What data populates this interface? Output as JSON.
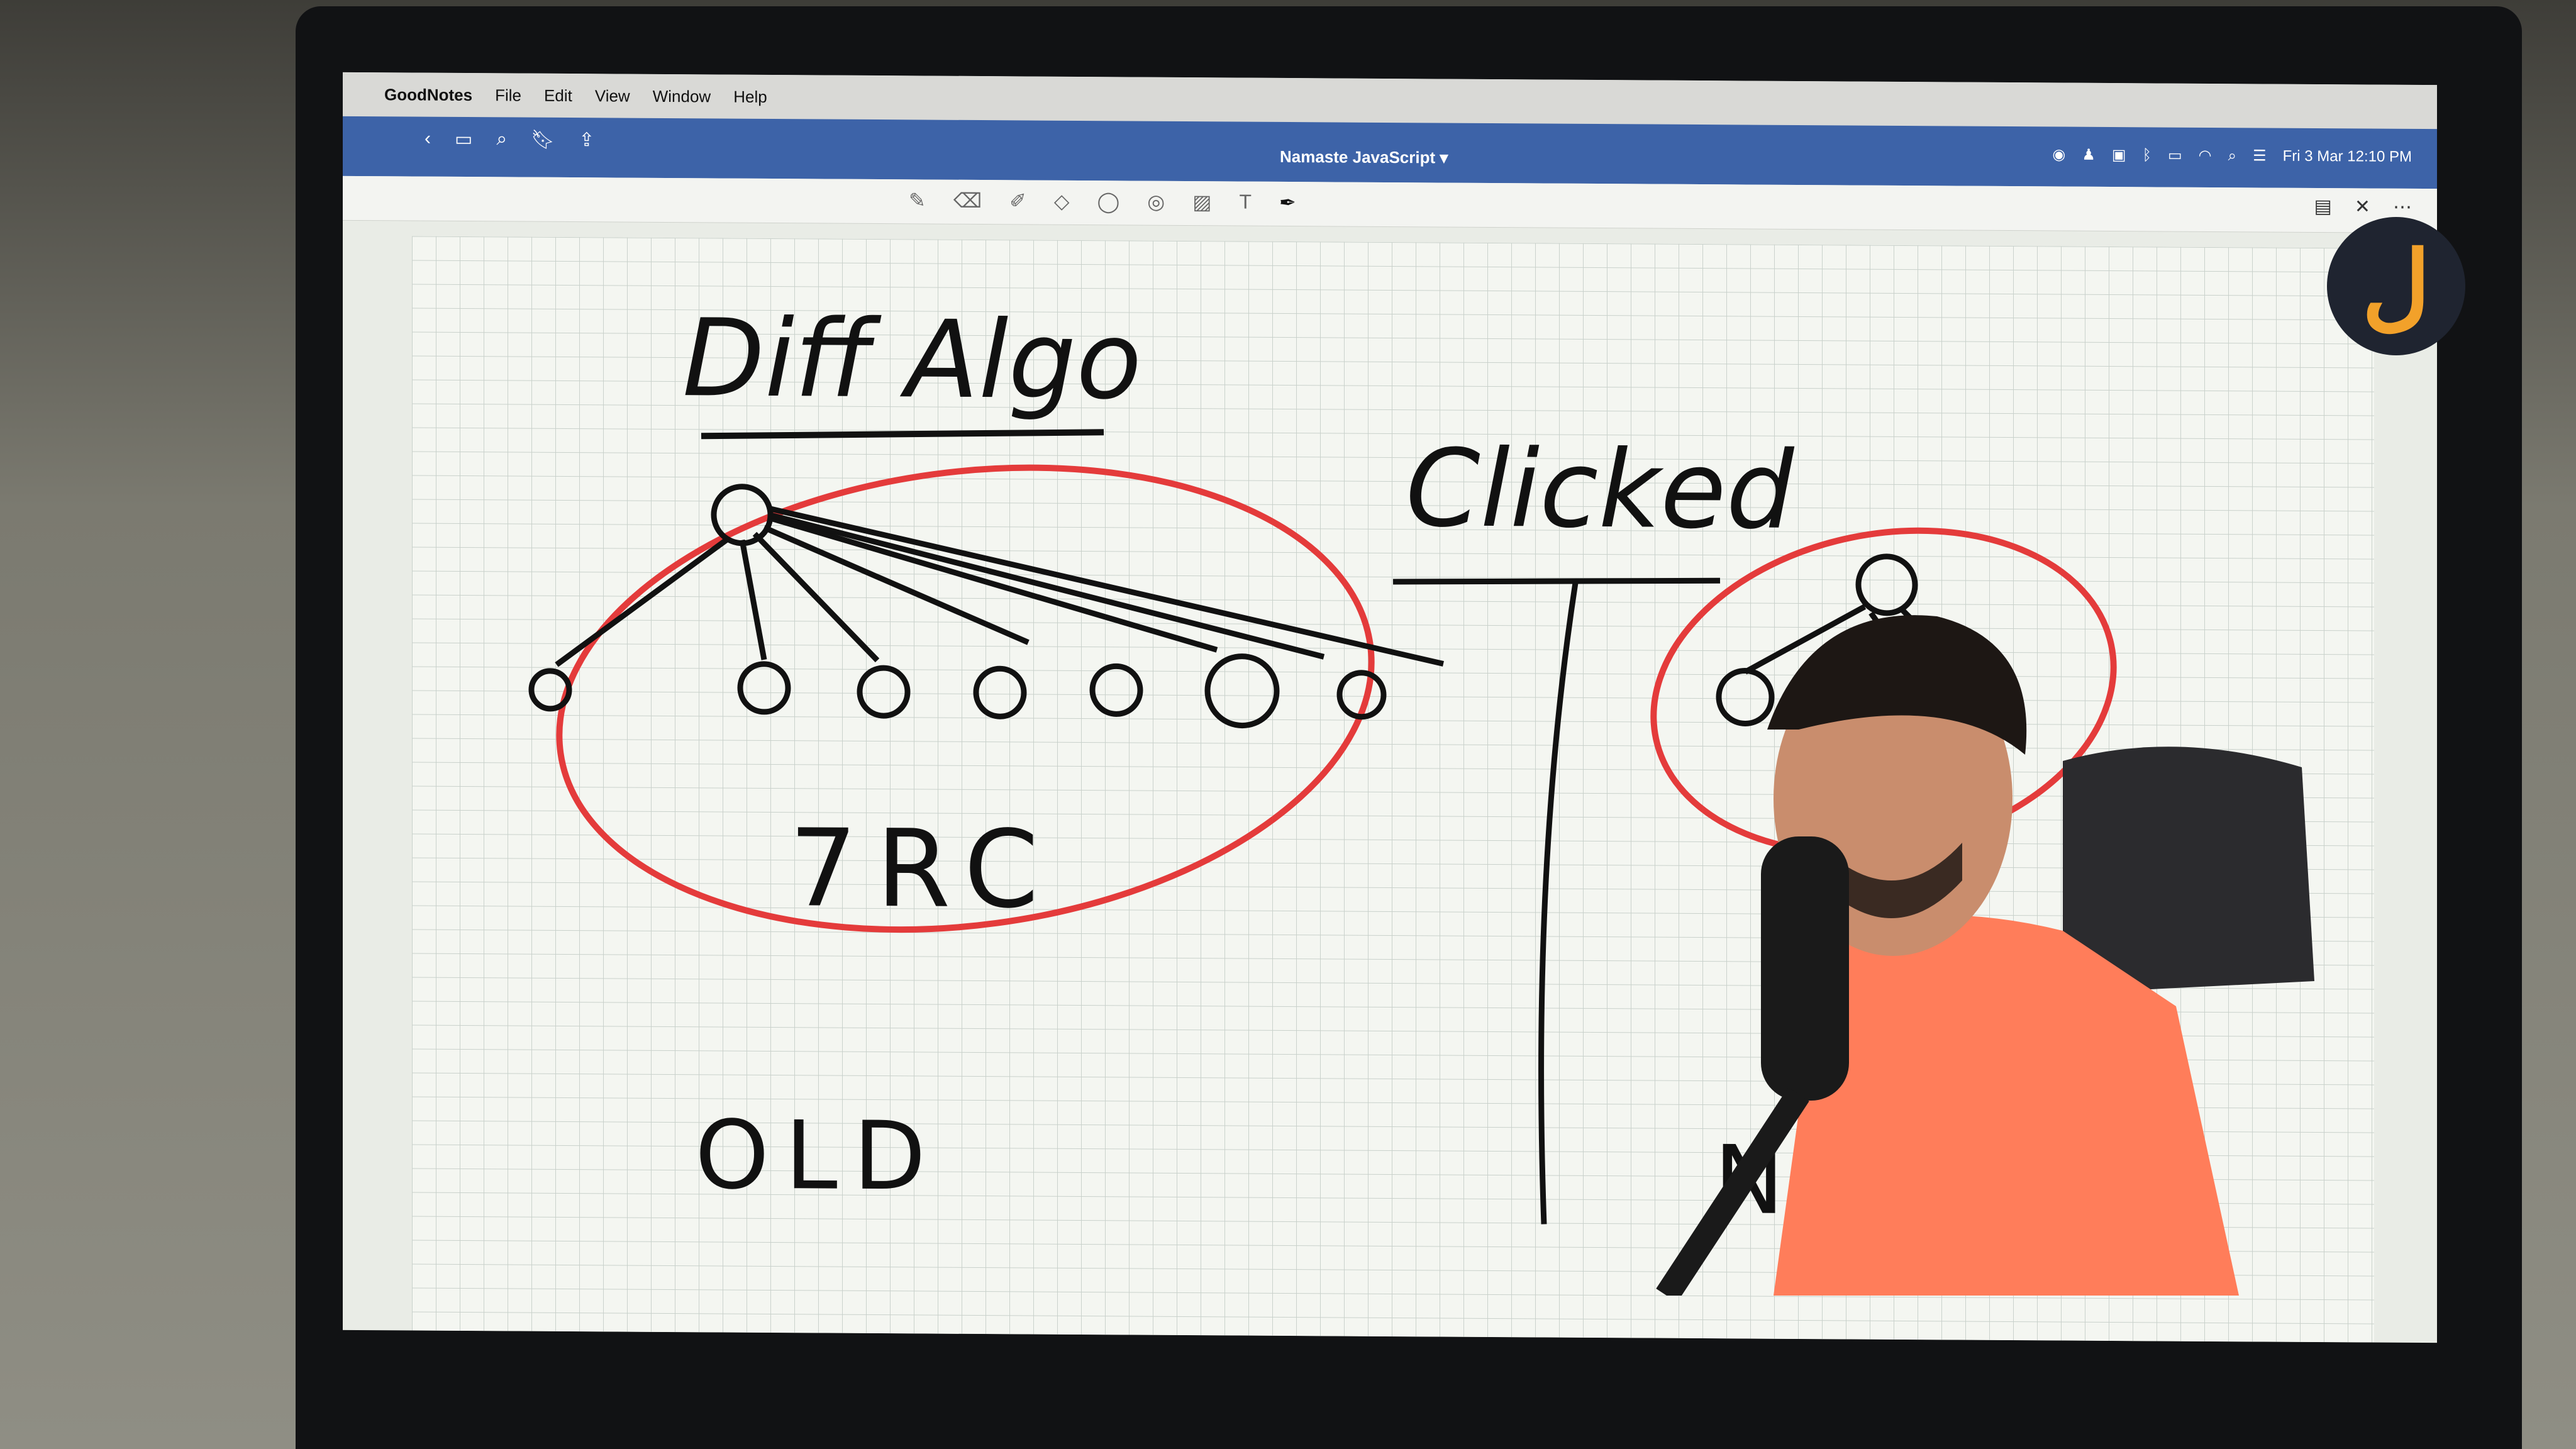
{
  "menubar": {
    "apple_icon": "apple-icon",
    "app_name": "GoodNotes",
    "items": [
      "File",
      "Edit",
      "View",
      "Window",
      "Help"
    ]
  },
  "titlebar": {
    "document_title": "Namaste JavaScript",
    "datetime": "Fri 3 Mar  12:10 PM"
  },
  "toolbar": {
    "tools": [
      "pen-icon",
      "eraser-icon",
      "highlighter-icon",
      "shapes-icon",
      "lasso-icon",
      "camera-icon",
      "image-icon",
      "text-icon",
      "laser-icon"
    ]
  },
  "canvas": {
    "heading": "Diff Algo",
    "center_label": "Clicked",
    "old_tree_label": "7RC",
    "left_label": "OLD",
    "right_label": "NEW"
  },
  "colors": {
    "titlebar": "#3d63a8",
    "ink": "#111111",
    "highlight": "#e43b3b",
    "logo": "#f2a12a"
  }
}
